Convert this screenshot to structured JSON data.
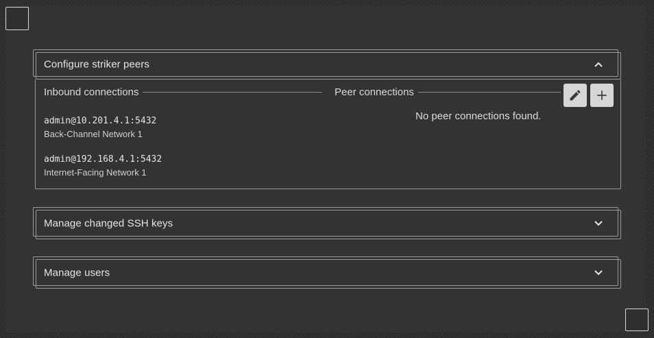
{
  "sections": {
    "striker_peers": {
      "title": "Configure striker peers",
      "expanded": true,
      "inbound": {
        "label": "Inbound connections",
        "connections": [
          {
            "address": "admin@10.201.4.1:5432",
            "network": "Back-Channel Network 1"
          },
          {
            "address": "admin@192.168.4.1:5432",
            "network": "Internet-Facing Network 1"
          }
        ]
      },
      "peer": {
        "label": "Peer connections",
        "empty_message": "No peer connections found."
      },
      "edit_icon": "pencil-icon",
      "add_icon": "plus-icon"
    },
    "ssh_keys": {
      "title": "Manage changed SSH keys",
      "expanded": false
    },
    "users": {
      "title": "Manage users",
      "expanded": false
    }
  },
  "colors": {
    "background": "#2d2d2d",
    "panel": "#333333",
    "border": "#9a9a9a",
    "text": "#e6e6e6",
    "button_bg": "#d6d6d6",
    "button_icon": "#3a3a3a"
  }
}
